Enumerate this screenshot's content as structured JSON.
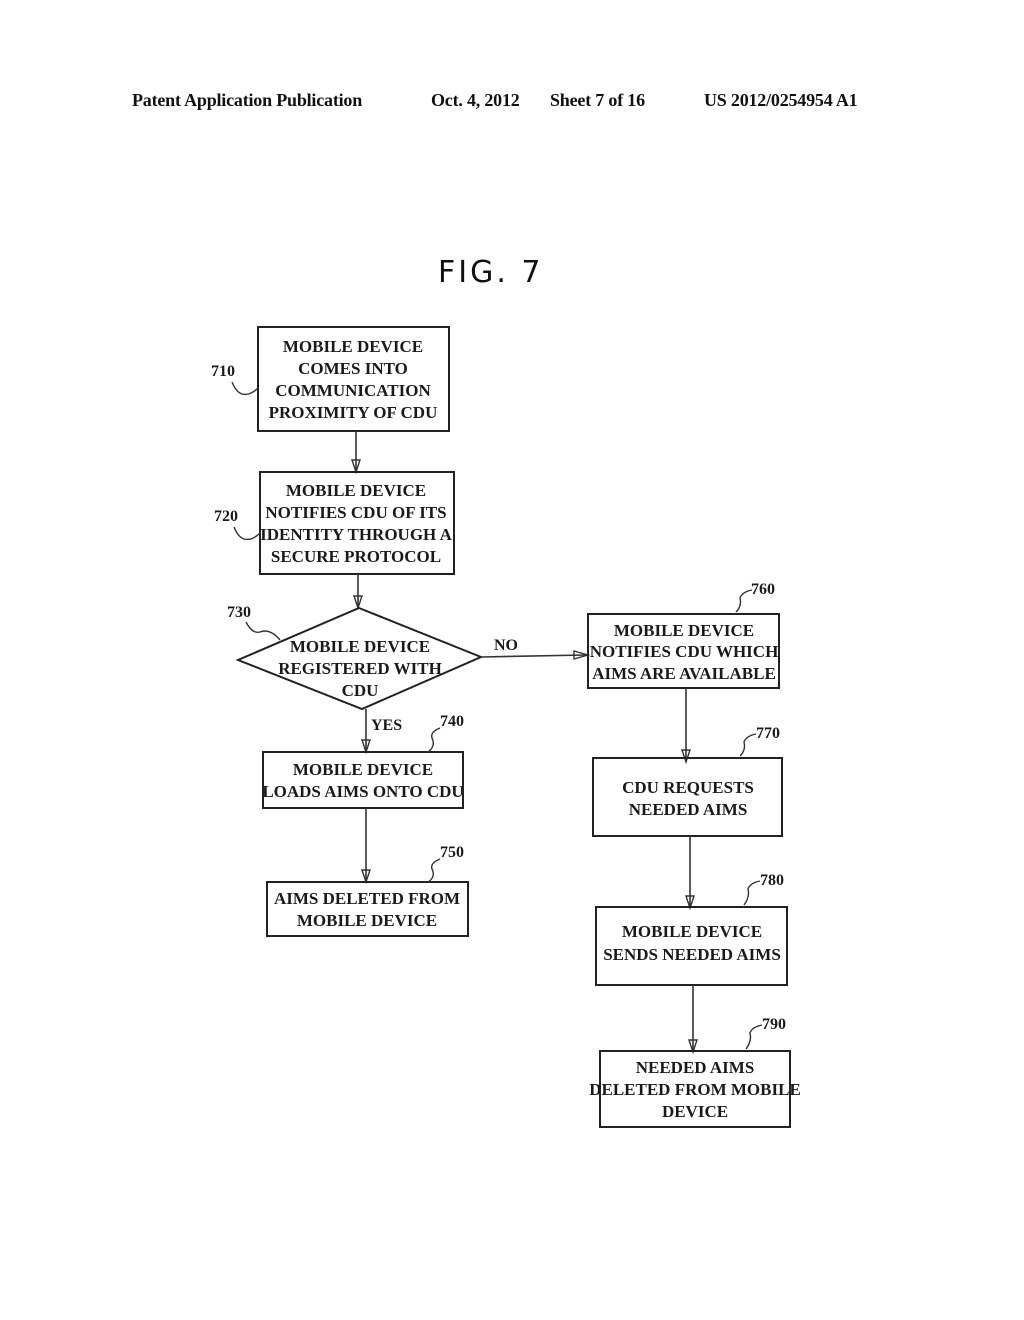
{
  "header": {
    "publication": "Patent Application Publication",
    "date": "Oct. 4, 2012",
    "sheet": "Sheet 7 of 16",
    "number": "US 2012/0254954 A1"
  },
  "figure": {
    "title": "FIG. 7"
  },
  "nodes": {
    "n710": {
      "ref": "710",
      "lines": [
        "MOBILE DEVICE",
        "COMES INTO",
        "COMMUNICATION",
        "PROXIMITY OF CDU"
      ]
    },
    "n720": {
      "ref": "720",
      "lines": [
        "MOBILE DEVICE",
        "NOTIFIES CDU OF ITS",
        "IDENTITY THROUGH A",
        "SECURE PROTOCOL"
      ]
    },
    "n730": {
      "ref": "730",
      "lines": [
        "MOBILE DEVICE",
        "REGISTERED WITH",
        "CDU"
      ]
    },
    "n740": {
      "ref": "740",
      "lines": [
        "MOBILE DEVICE",
        "LOADS AIMS ONTO CDU"
      ]
    },
    "n750": {
      "ref": "750",
      "lines": [
        "AIMS DELETED FROM",
        "MOBILE DEVICE"
      ]
    },
    "n760": {
      "ref": "760",
      "lines": [
        "MOBILE DEVICE",
        "NOTIFIES CDU WHICH",
        "AIMS ARE AVAILABLE"
      ]
    },
    "n770": {
      "ref": "770",
      "lines": [
        "CDU REQUESTS",
        "NEEDED AIMS"
      ]
    },
    "n780": {
      "ref": "780",
      "lines": [
        "MOBILE DEVICE",
        "SENDS NEEDED AIMS"
      ]
    },
    "n790": {
      "ref": "790",
      "lines": [
        "NEEDED AIMS",
        "DELETED FROM MOBILE",
        "DEVICE"
      ]
    }
  },
  "edges": {
    "no_label": "NO",
    "yes_label": "YES"
  }
}
